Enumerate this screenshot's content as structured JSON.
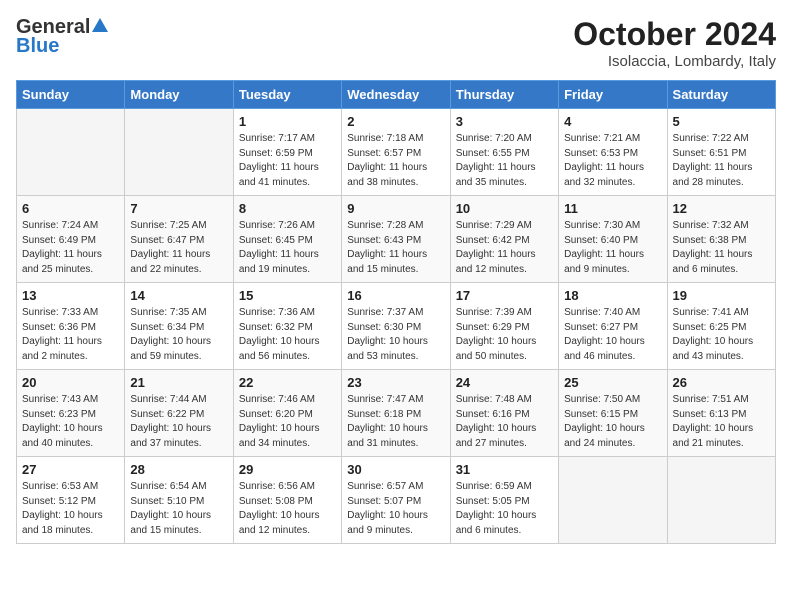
{
  "header": {
    "logo_general": "General",
    "logo_blue": "Blue",
    "month_year": "October 2024",
    "location": "Isolaccia, Lombardy, Italy"
  },
  "days_of_week": [
    "Sunday",
    "Monday",
    "Tuesday",
    "Wednesday",
    "Thursday",
    "Friday",
    "Saturday"
  ],
  "weeks": [
    [
      {
        "day": "",
        "empty": true
      },
      {
        "day": "",
        "empty": true
      },
      {
        "day": "1",
        "sunrise": "Sunrise: 7:17 AM",
        "sunset": "Sunset: 6:59 PM",
        "daylight": "Daylight: 11 hours and 41 minutes."
      },
      {
        "day": "2",
        "sunrise": "Sunrise: 7:18 AM",
        "sunset": "Sunset: 6:57 PM",
        "daylight": "Daylight: 11 hours and 38 minutes."
      },
      {
        "day": "3",
        "sunrise": "Sunrise: 7:20 AM",
        "sunset": "Sunset: 6:55 PM",
        "daylight": "Daylight: 11 hours and 35 minutes."
      },
      {
        "day": "4",
        "sunrise": "Sunrise: 7:21 AM",
        "sunset": "Sunset: 6:53 PM",
        "daylight": "Daylight: 11 hours and 32 minutes."
      },
      {
        "day": "5",
        "sunrise": "Sunrise: 7:22 AM",
        "sunset": "Sunset: 6:51 PM",
        "daylight": "Daylight: 11 hours and 28 minutes."
      }
    ],
    [
      {
        "day": "6",
        "sunrise": "Sunrise: 7:24 AM",
        "sunset": "Sunset: 6:49 PM",
        "daylight": "Daylight: 11 hours and 25 minutes."
      },
      {
        "day": "7",
        "sunrise": "Sunrise: 7:25 AM",
        "sunset": "Sunset: 6:47 PM",
        "daylight": "Daylight: 11 hours and 22 minutes."
      },
      {
        "day": "8",
        "sunrise": "Sunrise: 7:26 AM",
        "sunset": "Sunset: 6:45 PM",
        "daylight": "Daylight: 11 hours and 19 minutes."
      },
      {
        "day": "9",
        "sunrise": "Sunrise: 7:28 AM",
        "sunset": "Sunset: 6:43 PM",
        "daylight": "Daylight: 11 hours and 15 minutes."
      },
      {
        "day": "10",
        "sunrise": "Sunrise: 7:29 AM",
        "sunset": "Sunset: 6:42 PM",
        "daylight": "Daylight: 11 hours and 12 minutes."
      },
      {
        "day": "11",
        "sunrise": "Sunrise: 7:30 AM",
        "sunset": "Sunset: 6:40 PM",
        "daylight": "Daylight: 11 hours and 9 minutes."
      },
      {
        "day": "12",
        "sunrise": "Sunrise: 7:32 AM",
        "sunset": "Sunset: 6:38 PM",
        "daylight": "Daylight: 11 hours and 6 minutes."
      }
    ],
    [
      {
        "day": "13",
        "sunrise": "Sunrise: 7:33 AM",
        "sunset": "Sunset: 6:36 PM",
        "daylight": "Daylight: 11 hours and 2 minutes."
      },
      {
        "day": "14",
        "sunrise": "Sunrise: 7:35 AM",
        "sunset": "Sunset: 6:34 PM",
        "daylight": "Daylight: 10 hours and 59 minutes."
      },
      {
        "day": "15",
        "sunrise": "Sunrise: 7:36 AM",
        "sunset": "Sunset: 6:32 PM",
        "daylight": "Daylight: 10 hours and 56 minutes."
      },
      {
        "day": "16",
        "sunrise": "Sunrise: 7:37 AM",
        "sunset": "Sunset: 6:30 PM",
        "daylight": "Daylight: 10 hours and 53 minutes."
      },
      {
        "day": "17",
        "sunrise": "Sunrise: 7:39 AM",
        "sunset": "Sunset: 6:29 PM",
        "daylight": "Daylight: 10 hours and 50 minutes."
      },
      {
        "day": "18",
        "sunrise": "Sunrise: 7:40 AM",
        "sunset": "Sunset: 6:27 PM",
        "daylight": "Daylight: 10 hours and 46 minutes."
      },
      {
        "day": "19",
        "sunrise": "Sunrise: 7:41 AM",
        "sunset": "Sunset: 6:25 PM",
        "daylight": "Daylight: 10 hours and 43 minutes."
      }
    ],
    [
      {
        "day": "20",
        "sunrise": "Sunrise: 7:43 AM",
        "sunset": "Sunset: 6:23 PM",
        "daylight": "Daylight: 10 hours and 40 minutes."
      },
      {
        "day": "21",
        "sunrise": "Sunrise: 7:44 AM",
        "sunset": "Sunset: 6:22 PM",
        "daylight": "Daylight: 10 hours and 37 minutes."
      },
      {
        "day": "22",
        "sunrise": "Sunrise: 7:46 AM",
        "sunset": "Sunset: 6:20 PM",
        "daylight": "Daylight: 10 hours and 34 minutes."
      },
      {
        "day": "23",
        "sunrise": "Sunrise: 7:47 AM",
        "sunset": "Sunset: 6:18 PM",
        "daylight": "Daylight: 10 hours and 31 minutes."
      },
      {
        "day": "24",
        "sunrise": "Sunrise: 7:48 AM",
        "sunset": "Sunset: 6:16 PM",
        "daylight": "Daylight: 10 hours and 27 minutes."
      },
      {
        "day": "25",
        "sunrise": "Sunrise: 7:50 AM",
        "sunset": "Sunset: 6:15 PM",
        "daylight": "Daylight: 10 hours and 24 minutes."
      },
      {
        "day": "26",
        "sunrise": "Sunrise: 7:51 AM",
        "sunset": "Sunset: 6:13 PM",
        "daylight": "Daylight: 10 hours and 21 minutes."
      }
    ],
    [
      {
        "day": "27",
        "sunrise": "Sunrise: 6:53 AM",
        "sunset": "Sunset: 5:12 PM",
        "daylight": "Daylight: 10 hours and 18 minutes."
      },
      {
        "day": "28",
        "sunrise": "Sunrise: 6:54 AM",
        "sunset": "Sunset: 5:10 PM",
        "daylight": "Daylight: 10 hours and 15 minutes."
      },
      {
        "day": "29",
        "sunrise": "Sunrise: 6:56 AM",
        "sunset": "Sunset: 5:08 PM",
        "daylight": "Daylight: 10 hours and 12 minutes."
      },
      {
        "day": "30",
        "sunrise": "Sunrise: 6:57 AM",
        "sunset": "Sunset: 5:07 PM",
        "daylight": "Daylight: 10 hours and 9 minutes."
      },
      {
        "day": "31",
        "sunrise": "Sunrise: 6:59 AM",
        "sunset": "Sunset: 5:05 PM",
        "daylight": "Daylight: 10 hours and 6 minutes."
      },
      {
        "day": "",
        "empty": true
      },
      {
        "day": "",
        "empty": true
      }
    ]
  ]
}
